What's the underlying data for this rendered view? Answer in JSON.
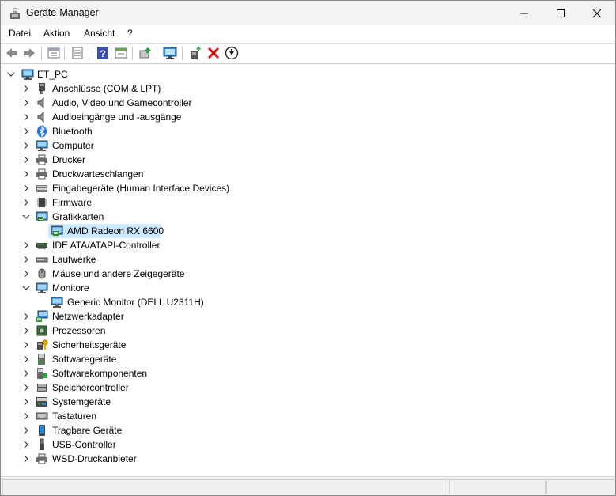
{
  "window": {
    "title": "Geräte-Manager"
  },
  "menu": [
    "Datei",
    "Aktion",
    "Ansicht",
    "?"
  ],
  "toolbar": {
    "buttons": [
      "back-icon",
      "forward-icon",
      "properties-icon",
      "list-view-icon",
      "help-icon",
      "device-view-icon",
      "update-driver-icon",
      "scan-hardware-icon",
      "add-legacy-icon",
      "uninstall-icon",
      "disable-icon"
    ]
  },
  "tree": {
    "root": "ET_PC",
    "items": [
      {
        "label": "Anschlüsse (COM & LPT)",
        "icon": "port-icon",
        "expanded": false
      },
      {
        "label": "Audio, Video und Gamecontroller",
        "icon": "speaker-icon",
        "expanded": false
      },
      {
        "label": "Audioeingänge und -ausgänge",
        "icon": "speaker-icon",
        "expanded": false
      },
      {
        "label": "Bluetooth",
        "icon": "bluetooth-icon",
        "expanded": false
      },
      {
        "label": "Computer",
        "icon": "computer-icon",
        "expanded": false
      },
      {
        "label": "Drucker",
        "icon": "printer-icon",
        "expanded": false
      },
      {
        "label": "Druckwarteschlangen",
        "icon": "printer-icon",
        "expanded": false
      },
      {
        "label": "Eingabegeräte (Human Interface Devices)",
        "icon": "hid-icon",
        "expanded": false
      },
      {
        "label": "Firmware",
        "icon": "chip-icon",
        "expanded": false
      },
      {
        "label": "Grafikkarten",
        "icon": "display-adapter-icon",
        "expanded": true,
        "children": [
          {
            "label": "AMD Radeon RX 6600",
            "icon": "display-adapter-icon",
            "selected": true
          }
        ]
      },
      {
        "label": "IDE ATA/ATAPI-Controller",
        "icon": "ide-icon",
        "expanded": false
      },
      {
        "label": "Laufwerke",
        "icon": "drive-icon",
        "expanded": false
      },
      {
        "label": "Mäuse und andere Zeigegeräte",
        "icon": "mouse-icon",
        "expanded": false
      },
      {
        "label": "Monitore",
        "icon": "monitor-icon",
        "expanded": true,
        "children": [
          {
            "label": "Generic Monitor (DELL U2311H)",
            "icon": "monitor-icon",
            "selected": false
          }
        ]
      },
      {
        "label": "Netzwerkadapter",
        "icon": "network-icon",
        "expanded": false
      },
      {
        "label": "Prozessoren",
        "icon": "cpu-icon",
        "expanded": false
      },
      {
        "label": "Sicherheitsgeräte",
        "icon": "security-icon",
        "expanded": false
      },
      {
        "label": "Softwaregeräte",
        "icon": "software-device-icon",
        "expanded": false
      },
      {
        "label": "Softwarekomponenten",
        "icon": "software-component-icon",
        "expanded": false
      },
      {
        "label": "Speichercontroller",
        "icon": "storage-controller-icon",
        "expanded": false
      },
      {
        "label": "Systemgeräte",
        "icon": "system-icon",
        "expanded": false
      },
      {
        "label": "Tastaturen",
        "icon": "keyboard-icon",
        "expanded": false
      },
      {
        "label": "Tragbare Geräte",
        "icon": "portable-icon",
        "expanded": false
      },
      {
        "label": "USB-Controller",
        "icon": "usb-icon",
        "expanded": false
      },
      {
        "label": "WSD-Druckanbieter",
        "icon": "printer-icon",
        "expanded": false
      }
    ]
  },
  "colors": {
    "selection": "#cce8ff",
    "accent_blue": "#1e88e5",
    "delete_red": "#d01010"
  }
}
